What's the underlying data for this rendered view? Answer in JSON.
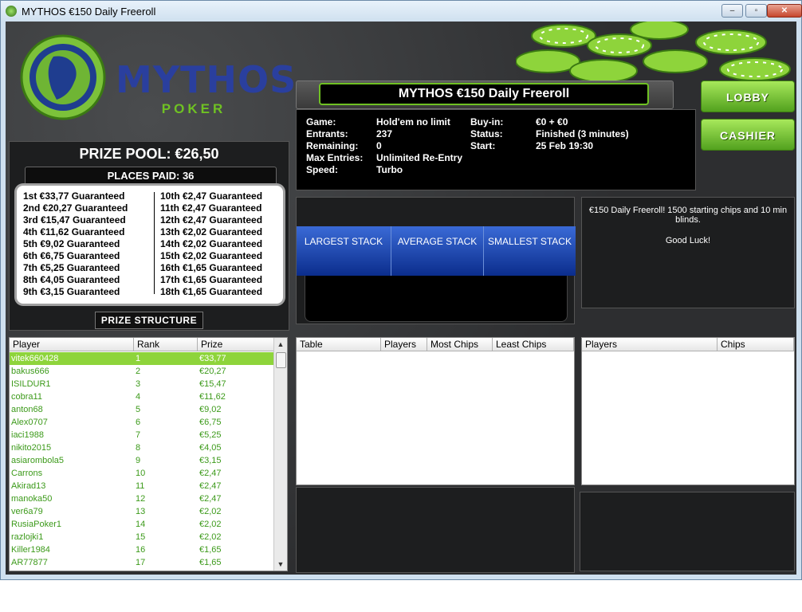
{
  "window": {
    "title": "MYTHOS €150 Daily Freeroll",
    "minimize": "–",
    "maximize": "▫",
    "close": "✕"
  },
  "logo": {
    "brand": "MYTHOS",
    "subtitle": "POKER"
  },
  "prize": {
    "pool_label": "PRIZE POOL: €26,50",
    "places_label": "PLACES PAID: 36",
    "left": [
      "1st €33,77 Guaranteed",
      "2nd €20,27 Guaranteed",
      "3rd €15,47 Guaranteed",
      "4th €11,62 Guaranteed",
      "5th €9,02 Guaranteed",
      "6th €6,75 Guaranteed",
      "7th €5,25 Guaranteed",
      "8th €4,05 Guaranteed",
      "9th €3,15 Guaranteed"
    ],
    "right": [
      "10th €2,47 Guaranteed",
      "11th €2,47 Guaranteed",
      "12th €2,47 Guaranteed",
      "13th €2,02 Guaranteed",
      "14th €2,02 Guaranteed",
      "15th €2,02 Guaranteed",
      "16th €1,65 Guaranteed",
      "17th €1,65 Guaranteed",
      "18th €1,65 Guaranteed"
    ],
    "structure_button": "PRIZE STRUCTURE"
  },
  "tournament": {
    "title": "MYTHOS €150 Daily Freeroll",
    "game_label": "Game:",
    "game_value": "Hold'em no limit",
    "entrants_label": "Entrants:",
    "entrants_value": "237",
    "remaining_label": "Remaining:",
    "remaining_value": "0",
    "max_entries_label": "Max Entries:",
    "max_entries_value": "Unlimited Re-Entry",
    "speed_label": "Speed:",
    "speed_value": "Turbo",
    "buyin_label": "Buy-in:",
    "buyin_value": "€0 + €0",
    "status_label": "Status:",
    "status_value": "Finished (3 minutes)",
    "start_label": "Start:",
    "start_value": "25 Feb 19:30",
    "description": "€150 Daily Freeroll!  1500 starting chips and 10 min blinds.",
    "good_luck": "Good Luck!"
  },
  "buttons": {
    "lobby": "LOBBY",
    "cashier": "CASHIER"
  },
  "stacks": {
    "largest": "LARGEST STACK",
    "average": "AVERAGE STACK",
    "smallest": "SMALLEST STACK"
  },
  "players_table": {
    "headers": [
      "Player",
      "Rank",
      "Prize"
    ],
    "rows": [
      [
        "vitek660428",
        "1",
        "€33,77"
      ],
      [
        "bakus666",
        "2",
        "€20,27"
      ],
      [
        "ISILDUR1",
        "3",
        "€15,47"
      ],
      [
        "cobra11",
        "4",
        "€11,62"
      ],
      [
        "anton68",
        "5",
        "€9,02"
      ],
      [
        "Alex0707",
        "6",
        "€6,75"
      ],
      [
        "iaci1988",
        "7",
        "€5,25"
      ],
      [
        "nikito2015",
        "8",
        "€4,05"
      ],
      [
        "asiarombola5",
        "9",
        "€3,15"
      ],
      [
        "Carrons",
        "10",
        "€2,47"
      ],
      [
        "Akirad13",
        "11",
        "€2,47"
      ],
      [
        "manoka50",
        "12",
        "€2,47"
      ],
      [
        "ver6a79",
        "13",
        "€2,02"
      ],
      [
        "RusiaPoker1",
        "14",
        "€2,02"
      ],
      [
        "razlojki1",
        "15",
        "€2,02"
      ],
      [
        "Killer1984",
        "16",
        "€1,65"
      ],
      [
        "AR77877",
        "17",
        "€1,65"
      ]
    ],
    "selected_index": 0
  },
  "tables_table": {
    "headers": [
      "Table",
      "Players",
      "Most Chips",
      "Least Chips"
    ]
  },
  "table_players": {
    "headers": [
      "Players",
      "Chips"
    ]
  },
  "colors": {
    "accent_green": "#8ed43b",
    "player_text": "#3c9a1a",
    "stack_blue": "#1a44b0",
    "logo_blue": "#2a3f9e"
  }
}
